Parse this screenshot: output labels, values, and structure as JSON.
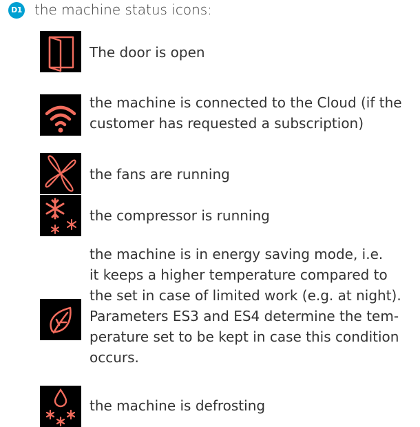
{
  "section": {
    "badge": "D1",
    "heading": "the machine status icons:",
    "accent_color": "#00a0d2",
    "icon_color": "#f26c5d"
  },
  "icons": [
    {
      "icon": "door-open-icon",
      "text": "The door is open"
    },
    {
      "icon": "wifi-cloud-icon",
      "text": "the machine is connected to the Cloud (if the customer has requested a subscription)",
      "line1": "the machine is connected to the Cloud (if the",
      "line2": "customer has requested a subscription)"
    },
    {
      "icon": "fan-icon",
      "text": "the fans are running"
    },
    {
      "icon": "snowflake-compressor-icon",
      "text": "the compressor is running"
    },
    {
      "icon": "leaf-energy-saving-icon",
      "text": "the machine is in energy saving mode, i.e. it keeps a higher temperature compared to the set in case of limited work (e.g. at night). Parameters ES3 and ES4 determine the temperature set to be kept in case this condition occurs.",
      "lines": [
        "the machine is in energy saving mode, i.e.",
        "it keeps a higher temperature compared to",
        "the set in case of limited work (e.g. at night).",
        "Parameters ES3 and ES4 determine the tem-",
        "perature set to be kept in case this condition",
        "occurs."
      ]
    },
    {
      "icon": "defrost-icon",
      "text": "the machine is defrosting"
    }
  ]
}
